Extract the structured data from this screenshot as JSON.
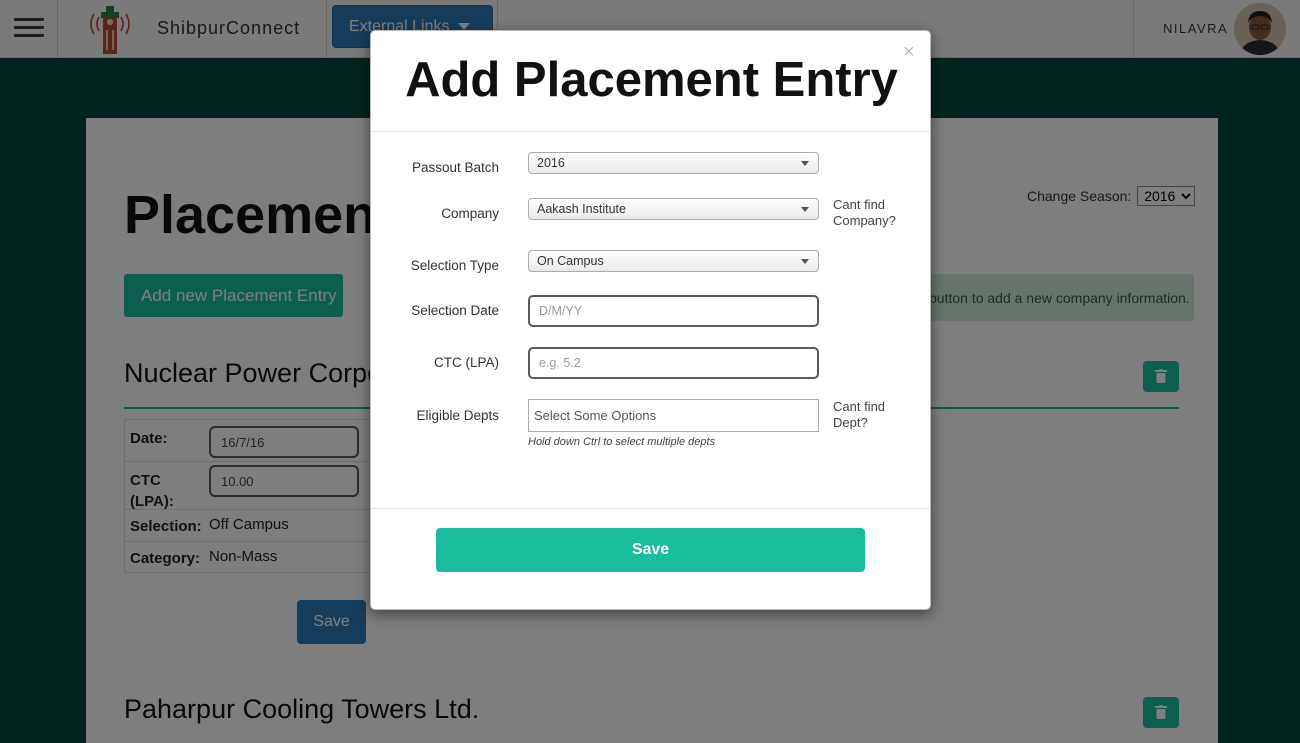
{
  "navbar": {
    "brand": "ShibpurConnect",
    "external_links_label": "External Links",
    "user_name": "NILAVRA"
  },
  "page": {
    "title": "Placements",
    "season_label": "Change Season:",
    "season_value": "2016",
    "add_button": "Add new Placement Entry",
    "info_text": "button to add a new company information.",
    "companies": [
      {
        "name": "Nuclear Power Corpo",
        "details": {
          "date_label": "Date:",
          "date_value": "16/7/16",
          "ctc_label": "CTC (LPA):",
          "ctc_value": "10.00",
          "selection_label": "Selection:",
          "selection_value": "Off Campus",
          "category_label": "Category:",
          "category_value": "Non-Mass"
        },
        "save_label": "Save"
      },
      {
        "name": "Paharpur Cooling Towers Ltd."
      }
    ]
  },
  "modal": {
    "title": "Add Placement Entry",
    "close": "×",
    "fields": {
      "passout_batch": {
        "label": "Passout Batch",
        "value": "2016"
      },
      "company": {
        "label": "Company",
        "value": "Aakash Institute",
        "help": "Cant find Company?"
      },
      "selection_type": {
        "label": "Selection Type",
        "value": "On Campus"
      },
      "selection_date": {
        "label": "Selection Date",
        "placeholder": "D/M/YY"
      },
      "ctc": {
        "label": "CTC (LPA)",
        "placeholder": "e.g. 5.2"
      },
      "eligible_depts": {
        "label": "Eligible Depts",
        "placeholder": "Select Some Options",
        "hint": "Hold down Ctrl to select multiple depts",
        "help": "Cant find Dept?"
      }
    },
    "save_label": "Save"
  },
  "colors": {
    "header_green": "#00483a",
    "accent_teal": "#18bc9c",
    "primary_blue": "#2d7ab8"
  }
}
